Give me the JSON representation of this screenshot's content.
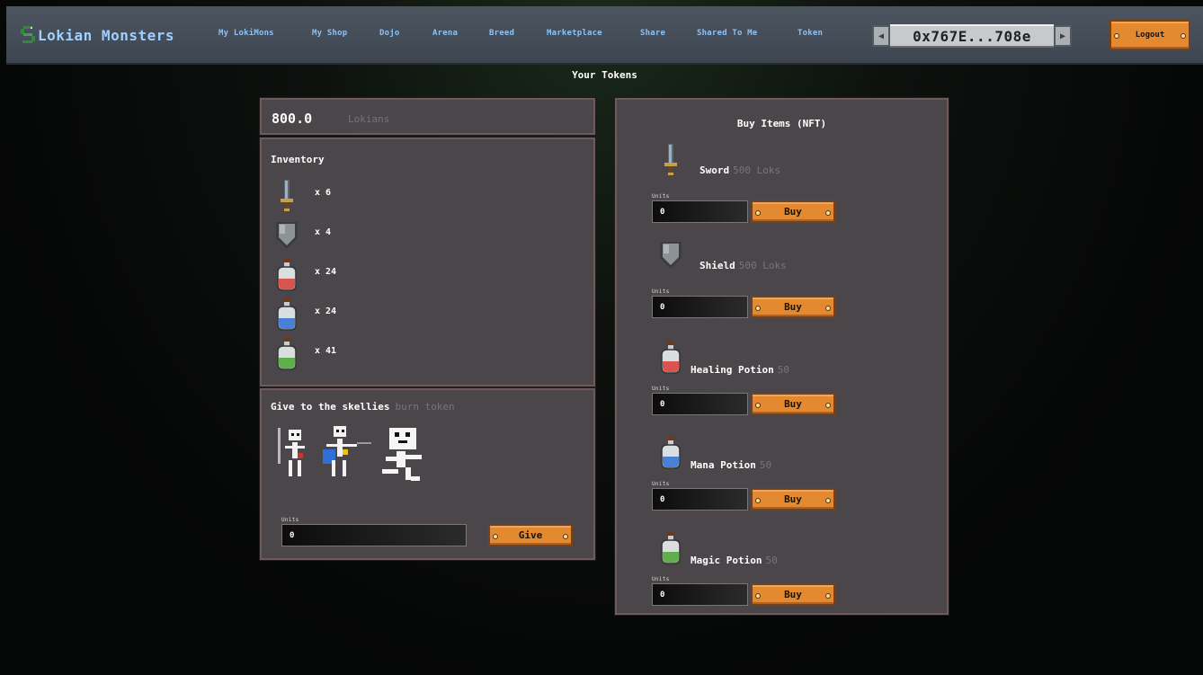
{
  "brand": {
    "name": "Lokian Monsters"
  },
  "nav": [
    {
      "label": "My LokiMons"
    },
    {
      "label": "My Shop"
    },
    {
      "label": "Dojo"
    },
    {
      "label": "Arena"
    },
    {
      "label": "Breed"
    },
    {
      "label": "Marketplace"
    },
    {
      "label": "Share"
    },
    {
      "label": "Shared To Me"
    },
    {
      "label": "Token"
    }
  ],
  "wallet": {
    "address": "0x767E...708e"
  },
  "logout_label": "Logout",
  "page_title": "Your Tokens",
  "balance": {
    "value": "800.0",
    "unit": "Lokians"
  },
  "inventory": {
    "title": "Inventory",
    "items": [
      {
        "icon": "sword-icon",
        "count": "x 6"
      },
      {
        "icon": "shield-icon",
        "count": "x 4"
      },
      {
        "icon": "healing-potion-icon",
        "count": "x 24"
      },
      {
        "icon": "mana-potion-icon",
        "count": "x 24"
      },
      {
        "icon": "magic-potion-icon",
        "count": "x 41"
      }
    ]
  },
  "give": {
    "title": "Give to the skellies",
    "subtitle": "burn token",
    "units_label": "Units",
    "units_value": "0",
    "button_label": "Give"
  },
  "shop": {
    "title": "Buy Items (NFT)",
    "items": [
      {
        "name": "Sword",
        "price": "500 Loks",
        "icon": "sword-icon",
        "units_label": "Units",
        "units_value": "0",
        "button_label": "Buy"
      },
      {
        "name": "Shield",
        "price": "500 Loks",
        "icon": "shield-icon",
        "units_label": "Units",
        "units_value": "0",
        "button_label": "Buy"
      },
      {
        "name": "Healing Potion",
        "price": "50",
        "icon": "healing-potion-icon",
        "units_label": "Units",
        "units_value": "0",
        "button_label": "Buy"
      },
      {
        "name": "Mana Potion",
        "price": "50",
        "icon": "mana-potion-icon",
        "units_label": "Units",
        "units_value": "0",
        "button_label": "Buy"
      },
      {
        "name": "Magic Potion",
        "price": "50",
        "icon": "magic-potion-icon",
        "units_label": "Units",
        "units_value": "0",
        "button_label": "Buy"
      }
    ]
  },
  "colors": {
    "accent": "#e3892f",
    "nav_link": "#8ec2f5",
    "panel_bg": "#4a4649",
    "healing": "#d9534f",
    "mana": "#4a7fd6",
    "magic": "#5fb04a"
  }
}
